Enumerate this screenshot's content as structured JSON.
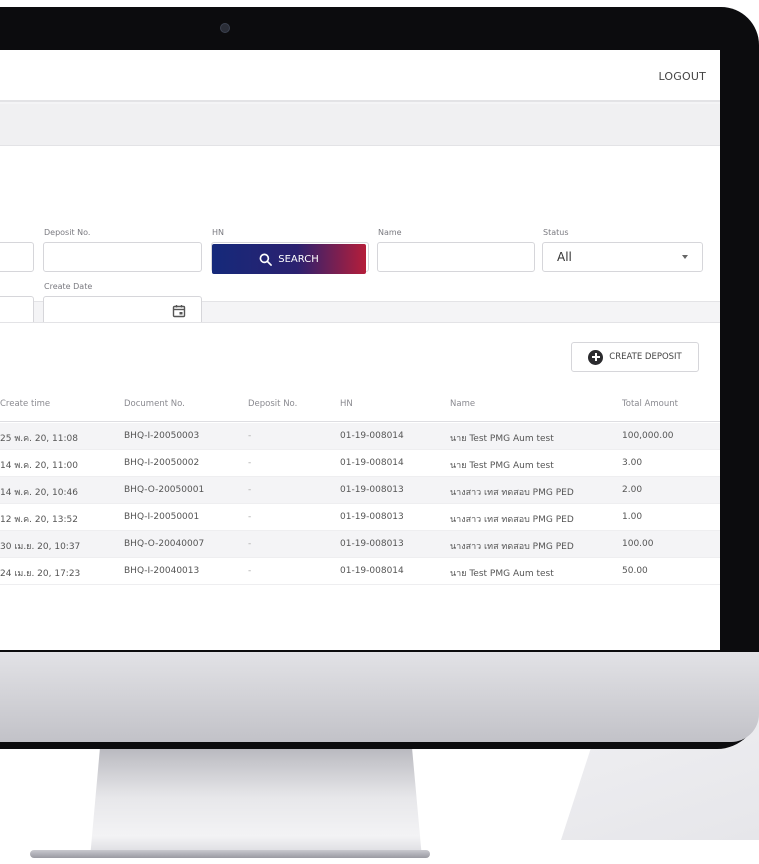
{
  "header": {
    "logout_label": "LOGOUT"
  },
  "filters": {
    "deposit_no_label": "Deposit No.",
    "hn_label": "HN",
    "name_label": "Name",
    "status_label": "Status",
    "status_value": "All",
    "create_date_label": "Create Date",
    "search_label": "SEARCH"
  },
  "list": {
    "create_deposit_label": "CREATE DEPOSIT",
    "columns": [
      "Create time",
      "Document No.",
      "Deposit No.",
      "HN",
      "Name",
      "Total Amount"
    ],
    "rows": [
      [
        "25 พ.ค. 20, 11:08",
        "BHQ-I-20050003",
        "-",
        "01-19-008014",
        "นาย Test PMG Aum test",
        "100,000.00"
      ],
      [
        "14 พ.ค. 20, 11:00",
        "BHQ-I-20050002",
        "-",
        "01-19-008014",
        "นาย Test PMG Aum test",
        "3.00"
      ],
      [
        "14 พ.ค. 20, 10:46",
        "BHQ-O-20050001",
        "-",
        "01-19-008013",
        "นางสาว เทส ทดสอบ PMG PED",
        "2.00"
      ],
      [
        "12 พ.ค. 20, 13:52",
        "BHQ-I-20050001",
        "-",
        "01-19-008013",
        "นางสาว เทส ทดสอบ PMG PED",
        "1.00"
      ],
      [
        "30 เม.ย. 20, 10:37",
        "BHQ-O-20040007",
        "-",
        "01-19-008013",
        "นางสาว เทส ทดสอบ PMG PED",
        "100.00"
      ],
      [
        "24 เม.ย. 20, 17:23",
        "BHQ-I-20040013",
        "-",
        "01-19-008014",
        "นาย Test PMG Aum test",
        "50.00"
      ]
    ]
  },
  "colors": {
    "search_gradient_start": "#15297a",
    "search_gradient_end": "#b51e3a"
  },
  "icons": [
    "search-icon",
    "calendar-icon",
    "plus-circle-icon",
    "chevron-down-icon"
  ]
}
